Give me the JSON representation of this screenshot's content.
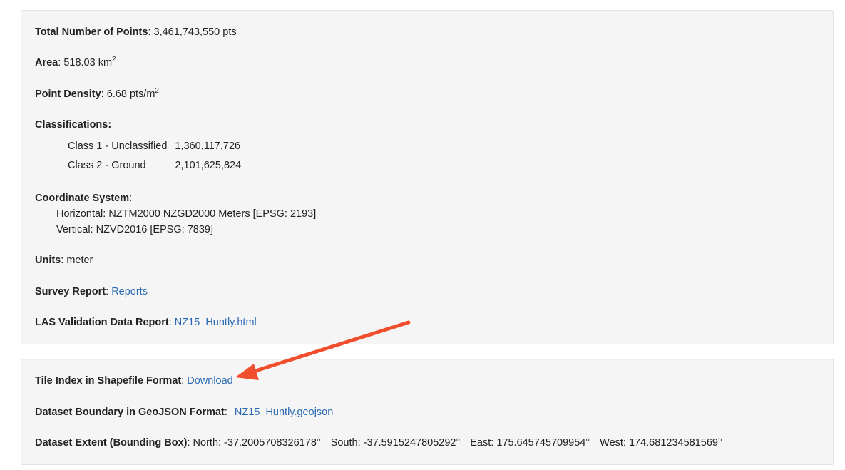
{
  "panel1": {
    "total_points": {
      "label": "Total Number of Points",
      "sep": ": ",
      "value": "3,461,743,550 pts"
    },
    "area": {
      "label": "Area",
      "sep": ": ",
      "value": "518.03 km",
      "sup": "2"
    },
    "density": {
      "label": "Point Density",
      "sep": ": ",
      "value": "6.68 pts/m",
      "sup": "2"
    },
    "classifications": {
      "label": "Classifications:",
      "rows": [
        {
          "name": "Class 1 - Unclassified",
          "count": "1,360,117,726"
        },
        {
          "name": "Class 2 - Ground",
          "count": "2,101,625,824"
        }
      ]
    },
    "coordinate_system": {
      "label": "Coordinate System",
      "sep": ":",
      "horizontal": "Horizontal: NZTM2000 NZGD2000 Meters [EPSG: 2193]",
      "vertical": "Vertical: NZVD2016 [EPSG: 7839]"
    },
    "units": {
      "label": "Units",
      "sep": ": ",
      "value": "meter"
    },
    "survey_report": {
      "label": "Survey Report",
      "sep": ": ",
      "link": "Reports"
    },
    "las_report": {
      "label": "LAS Validation Data Report",
      "sep": ": ",
      "link": "NZ15_Huntly.html"
    }
  },
  "panel2": {
    "tile_index": {
      "label": "Tile Index in Shapefile Format",
      "sep": ": ",
      "link": "Download"
    },
    "boundary": {
      "label": "Dataset Boundary in GeoJSON Format",
      "sep": ":",
      "link": "NZ15_Huntly.geojson"
    },
    "extent": {
      "label": "Dataset Extent (Bounding Box)",
      "sep": ": ",
      "north": "North: -37.2005708326178°",
      "south": "South: -37.5915247805292°",
      "east": "East: 175.645745709954°",
      "west": "West: 174.681234581569°"
    }
  },
  "colors": {
    "link": "#2a6ab4",
    "panel_bg": "#f5f5f5",
    "panel_border": "#e3e3e3",
    "arrow": "#f04e2d"
  },
  "icons": {
    "annotation": "arrow-annotation-icon"
  }
}
